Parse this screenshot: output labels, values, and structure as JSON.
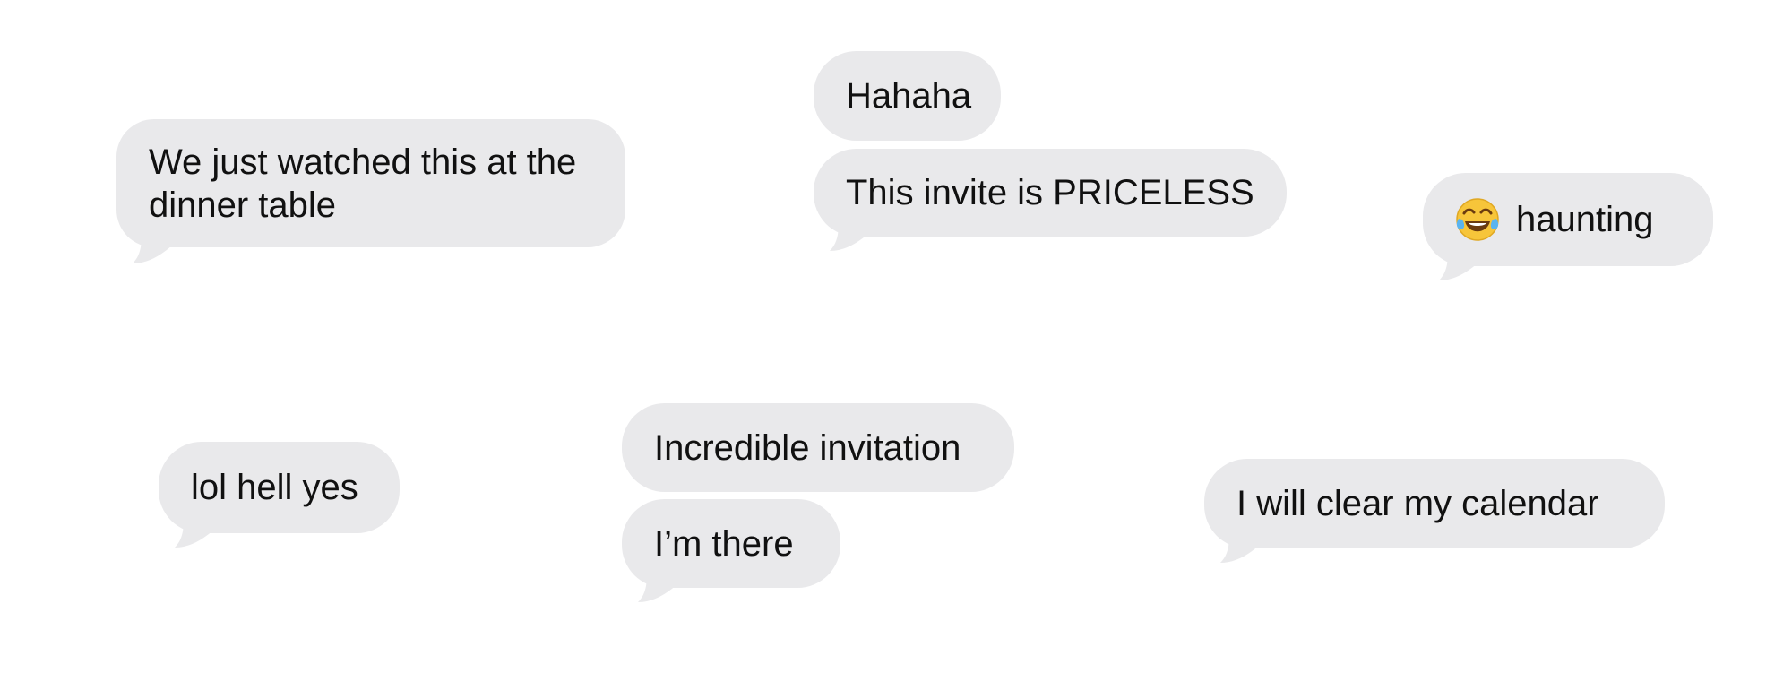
{
  "bubble_color": "#e9e9eb",
  "text_color": "#111111",
  "messages": [
    {
      "text": "We just watched this at the dinner table"
    },
    {
      "text": "Hahaha"
    },
    {
      "text": "This invite is PRICELESS"
    },
    {
      "emoji": "tears-of-joy-icon",
      "text": "haunting"
    },
    {
      "text": "lol hell yes"
    },
    {
      "text": "Incredible invitation"
    },
    {
      "text": "I’m there"
    },
    {
      "text": "I will clear my calendar"
    }
  ]
}
